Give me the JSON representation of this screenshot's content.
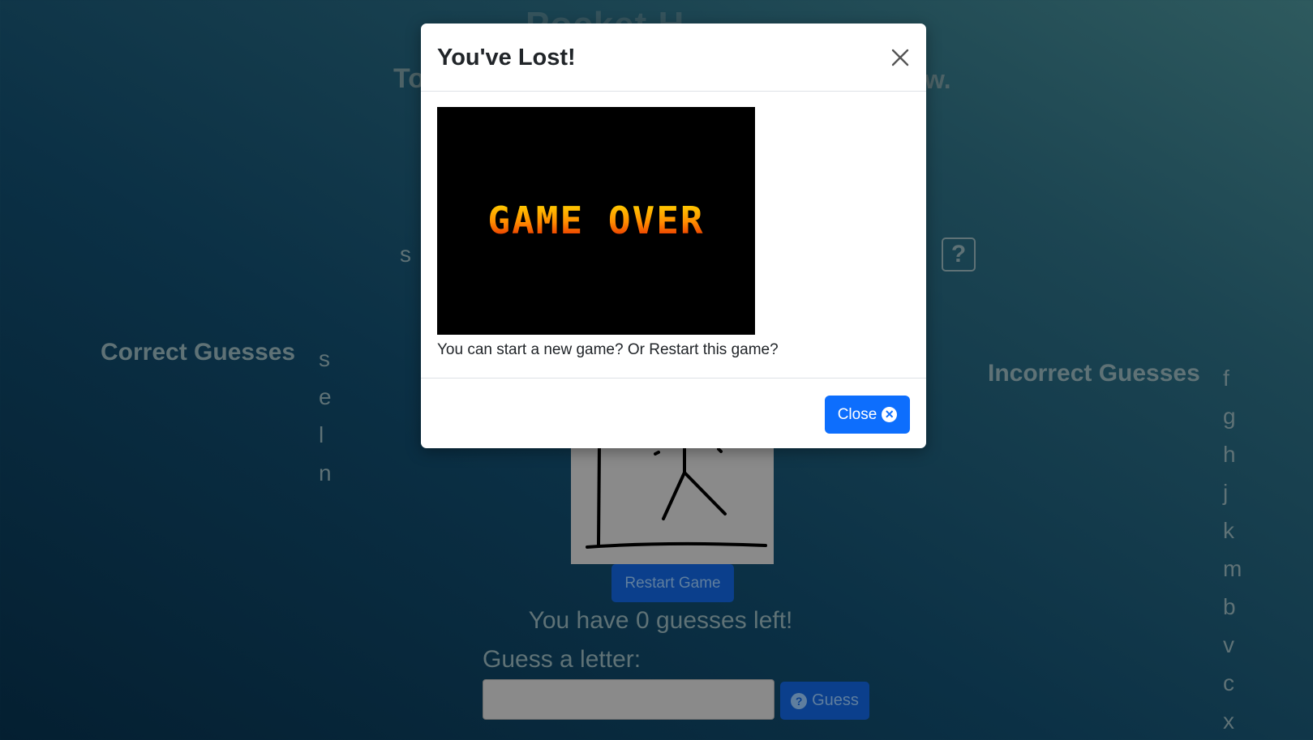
{
  "page": {
    "title_partial": "Pocket H",
    "subtitle_left": "To",
    "subtitle_right": "w.",
    "word_letter": "s",
    "help_icon": "?"
  },
  "correct": {
    "heading": "Correct Guesses",
    "letters": [
      "s",
      "e",
      "l",
      "n"
    ]
  },
  "incorrect": {
    "heading": "Incorrect Guesses",
    "letters": [
      "f",
      "g",
      "h",
      "j",
      "k",
      "m",
      "b",
      "v",
      "c",
      "x"
    ]
  },
  "game": {
    "restart_label": "Restart Game",
    "guesses_left": "You have 0 guesses left!",
    "guess_label": "Guess a letter:",
    "guess_input_value": "",
    "guess_button": "Guess",
    "guess_icon": "question-circle-icon"
  },
  "modal": {
    "title": "You've Lost!",
    "close_icon": "close-icon",
    "image_text": "GAME OVER",
    "message": "You can start a new game? Or Restart this game?",
    "close_button": "Close",
    "close_button_icon": "x-circle-icon"
  },
  "colors": {
    "primary": "#0d6efd",
    "background_dark": "#041f31",
    "background_light": "#2e5a5e"
  }
}
